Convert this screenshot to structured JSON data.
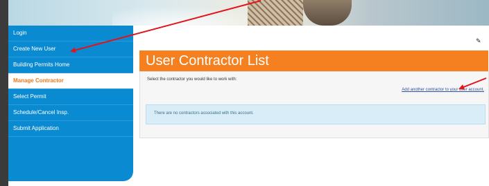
{
  "sidebar": {
    "items": [
      {
        "label": "Login"
      },
      {
        "label": "Create New User"
      },
      {
        "label": "Building Permits Home"
      },
      {
        "label": "Manage Contractor",
        "active": true
      },
      {
        "label": "Select Permit"
      },
      {
        "label": "Schedule/Cancel Insp."
      },
      {
        "label": "Submit Application"
      }
    ]
  },
  "main": {
    "title": "User Contractor List",
    "instruction": "Select the contractor you would like to work with:",
    "add_link": "Add another contractor to your user account.",
    "empty_message": "There are no contractors associated with this account."
  },
  "icons": {
    "edit": "pencil-icon"
  },
  "colors": {
    "sidebar": "#0a8ad0",
    "accent": "#f4801f",
    "active_text": "#f07a1a",
    "info_bg": "#d8edf7",
    "annotation_arrow": "#e3121b"
  }
}
